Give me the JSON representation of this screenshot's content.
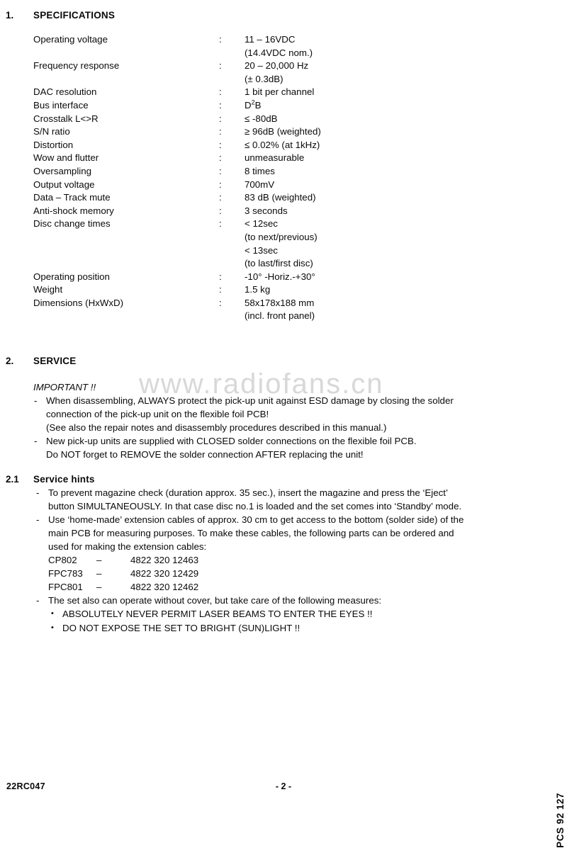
{
  "watermark": "www.radiofans.cn",
  "sections": {
    "specifications": {
      "number": "1.",
      "title": "SPECIFICATIONS",
      "colon": ":",
      "rows": [
        {
          "label": "Operating voltage",
          "value": "11 – 16VDC",
          "cont": "(14.4VDC nom.)"
        },
        {
          "label": "Frequency response",
          "value": "20 – 20,000 Hz",
          "cont": "(± 0.3dB)"
        },
        {
          "label": "DAC resolution",
          "value": "1 bit per channel",
          "cont": ""
        },
        {
          "label": "Bus interface",
          "value": "D2B",
          "cont": "",
          "sup": "2"
        },
        {
          "label": "Crosstalk L<>R",
          "value": "≤ -80dB",
          "cont": ""
        },
        {
          "label": "S/N ratio",
          "value": "≥ 96dB (weighted)",
          "cont": ""
        },
        {
          "label": "Distortion",
          "value": "≤ 0.02% (at 1kHz)",
          "cont": ""
        },
        {
          "label": "Wow and flutter",
          "value": "unmeasurable",
          "cont": ""
        },
        {
          "label": "Oversampling",
          "value": "8 times",
          "cont": ""
        },
        {
          "label": "Output voltage",
          "value": "700mV",
          "cont": ""
        },
        {
          "label": "Data – Track mute",
          "value": "83 dB (weighted)",
          "cont": ""
        },
        {
          "label": "Anti-shock memory",
          "value": "3 seconds",
          "cont": ""
        },
        {
          "label": "Disc change times",
          "value": "< 12sec",
          "cont": "(to next/previous)",
          "cont2": "< 13sec",
          "cont3": "(to last/first disc)"
        },
        {
          "label": "Operating position",
          "value": "-10° -Horiz.-+30°",
          "cont": ""
        },
        {
          "label": "Weight",
          "value": "1.5 kg",
          "cont": ""
        },
        {
          "label": "Dimensions (HxWxD)",
          "value": "58x178x188 mm",
          "cont": "(incl. front panel)"
        }
      ]
    },
    "service": {
      "number": "2.",
      "title": "SERVICE",
      "important_heading": "IMPORTANT !!",
      "dash": "-",
      "items": [
        {
          "line1": "When disassembling, ALWAYS protect the pick-up unit against ESD damage by closing the solder",
          "line2": "connection of the pick-up unit on the flexible foil PCB!",
          "line3": "(See also the repair notes and disassembly procedures described in this manual.)"
        },
        {
          "line1": "New pick-up units are supplied with CLOSED solder connections on the flexible foil PCB.",
          "line2": "Do NOT forget to REMOVE the solder connection AFTER replacing the unit!",
          "line3": ""
        }
      ]
    },
    "service_hints": {
      "number": "2.1",
      "title": "Service hints",
      "dash": "-",
      "item1": {
        "line1": "To prevent magazine check (duration approx. 35 sec.), insert the magazine and press the ‘Eject’",
        "line2": "button SIMULTANEOUSLY. In that case disc no.1 is loaded and the set comes into ‘Standby’ mode."
      },
      "item2": {
        "line1": "Use ‘home-made’ extension cables of approx. 30 cm to get access to the bottom (solder side) of the",
        "line2": "main PCB for measuring purposes. To make these cables, the following parts can be ordered and",
        "line3": "used for making the extension cables:"
      },
      "parts": [
        {
          "code": "CP802",
          "dash": "–",
          "number": "4822 320 12463"
        },
        {
          "code": "FPC783",
          "dash": "–",
          "number": "4822 320 12429"
        },
        {
          "code": "FPC801",
          "dash": "–",
          "number": "4822 320 12462"
        }
      ],
      "item3": {
        "line1": "The set also can operate without cover, but take care of the following measures:"
      },
      "bullet_char": "•",
      "bullets": [
        "ABSOLUTELY NEVER PERMIT LASER BEAMS TO ENTER THE EYES !!",
        "DO NOT EXPOSE THE SET TO BRIGHT (SUN)LIGHT !!"
      ]
    }
  },
  "footer": {
    "left_code": "22RC047",
    "page_number": "- 2 -",
    "side_code": "PCS 92 127"
  }
}
